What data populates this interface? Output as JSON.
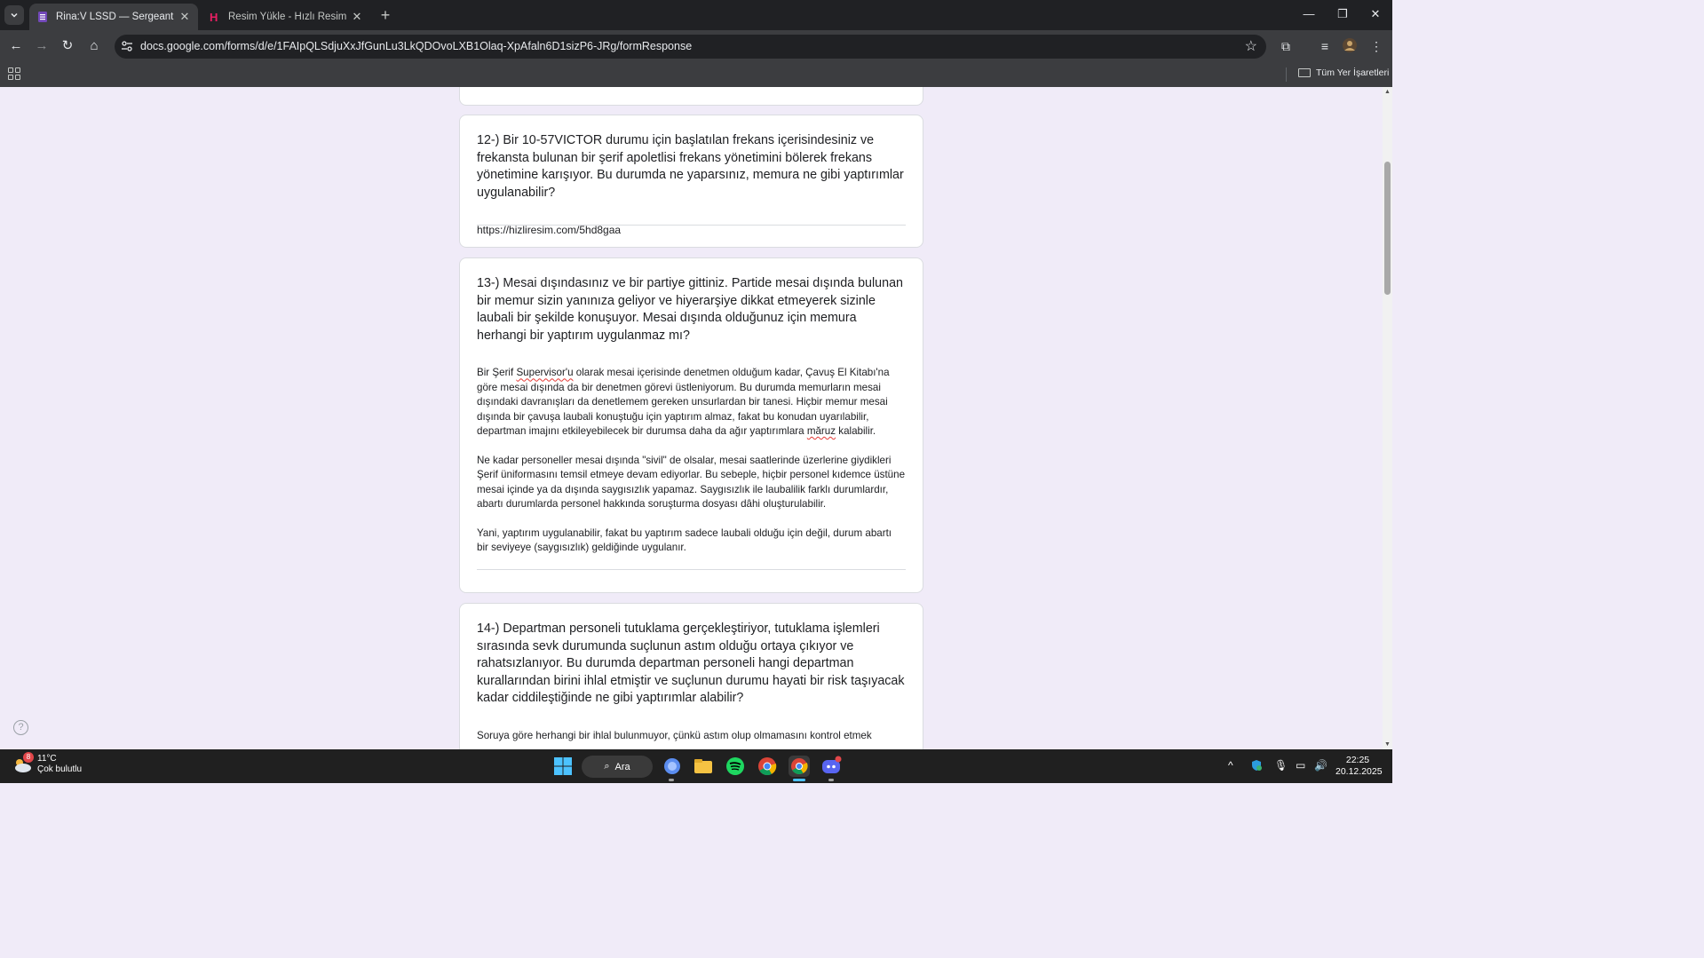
{
  "browser": {
    "tabs": [
      {
        "title": "Rina:V LSSD — Sergeant Exam",
        "active": true
      },
      {
        "title": "Resim Yükle - Hızlı Resim Paylaş",
        "active": false
      }
    ],
    "url": "docs.google.com/forms/d/e/1FAIpQLSdjuXxJfGunLu3LkQDOvoLXB1Olaq-XpAfaln6D1sizP6-JRg/formResponse",
    "bookmarks_all_label": "Tüm Yer İşaretleri"
  },
  "form": {
    "q12": {
      "question": "12-) Bir 10-57VICTOR durumu için başlatılan frekans içerisindesiniz ve frekansta bulunan bir şerif apoletlisi frekans yönetimini bölerek frekans yönetimine karışıyor. Bu durumda ne yaparsınız, memura ne gibi yaptırımlar uygulanabilir?",
      "answer": "https://hizliresim.com/5hd8gaa"
    },
    "q13": {
      "question": "13-) Mesai dışındasınız ve bir partiye gittiniz. Partide mesai dışında bulunan bir memur sizin yanınıza geliyor ve hiyerarşiye dikkat etmeyerek sizinle laubali bir şekilde konuşuyor. Mesai dışında olduğunuz için memura herhangi bir yaptırım uygulanmaz mı?",
      "answer_p1_a": "Bir Şerif ",
      "answer_p1_b": "Supervisor'u",
      "answer_p1_c": " olarak mesai içerisinde denetmen olduğum kadar, Çavuş El Kitabı'na göre mesai dışında da bir denetmen görevi üstleniyorum. Bu durumda memurların mesai dışındaki davranışları da denetlemem gereken unsurlardan bir tanesi. Hiçbir memur mesai dışında bir çavuşa laubali konuştuğu için yaptırım almaz, fakat bu konudan uyarılabilir, departman imajını etkileyebilecek bir durumsa daha da ağır yaptırımlara ",
      "answer_p1_d": "măruz",
      "answer_p1_e": " kalabilir.",
      "answer_p2": "Ne kadar personeller mesai dışında \"sivil\" de olsalar, mesai saatlerinde üzerlerine giydikleri Şerif üniformasını temsil etmeye devam ediyorlar. Bu sebeple, hiçbir personel kıdemce üstüne mesai içinde ya da dışında saygısızlık yapamaz. Saygısızlık ile laubalilik farklı durumlardır, abartı durumlarda personel hakkında soruşturma dosyası dâhi oluşturulabilir.",
      "answer_p3": "Yani, yaptırım uygulanabilir, fakat bu yaptırım sadece laubali olduğu için değil, durum abartı bir seviyeye (saygısızlık) geldiğinde uygulanır."
    },
    "q14": {
      "question": "14-)  Departman personeli tutuklama gerçekleştiriyor, tutuklama işlemleri sırasında sevk durumunda suçlunun astım olduğu ortaya çıkıyor ve rahatsızlanıyor. Bu durumda departman personeli hangi departman kurallarından birini ihlal etmiştir ve suçlunun durumu hayati bir risk taşıyacak kadar ciddileştiğinde ne gibi yaptırımlar alabilir?",
      "answer_partial": "Soruya göre herhangi bir ihlal bulunmuyor, çünkü astım olup olmamasını kontrol etmek"
    }
  },
  "taskbar": {
    "weather_temp": "11°C",
    "weather_desc": "Çok bulutlu",
    "weather_badge": "8",
    "search_label": "Ara",
    "time": "22:25",
    "date": "20.12.2025"
  }
}
